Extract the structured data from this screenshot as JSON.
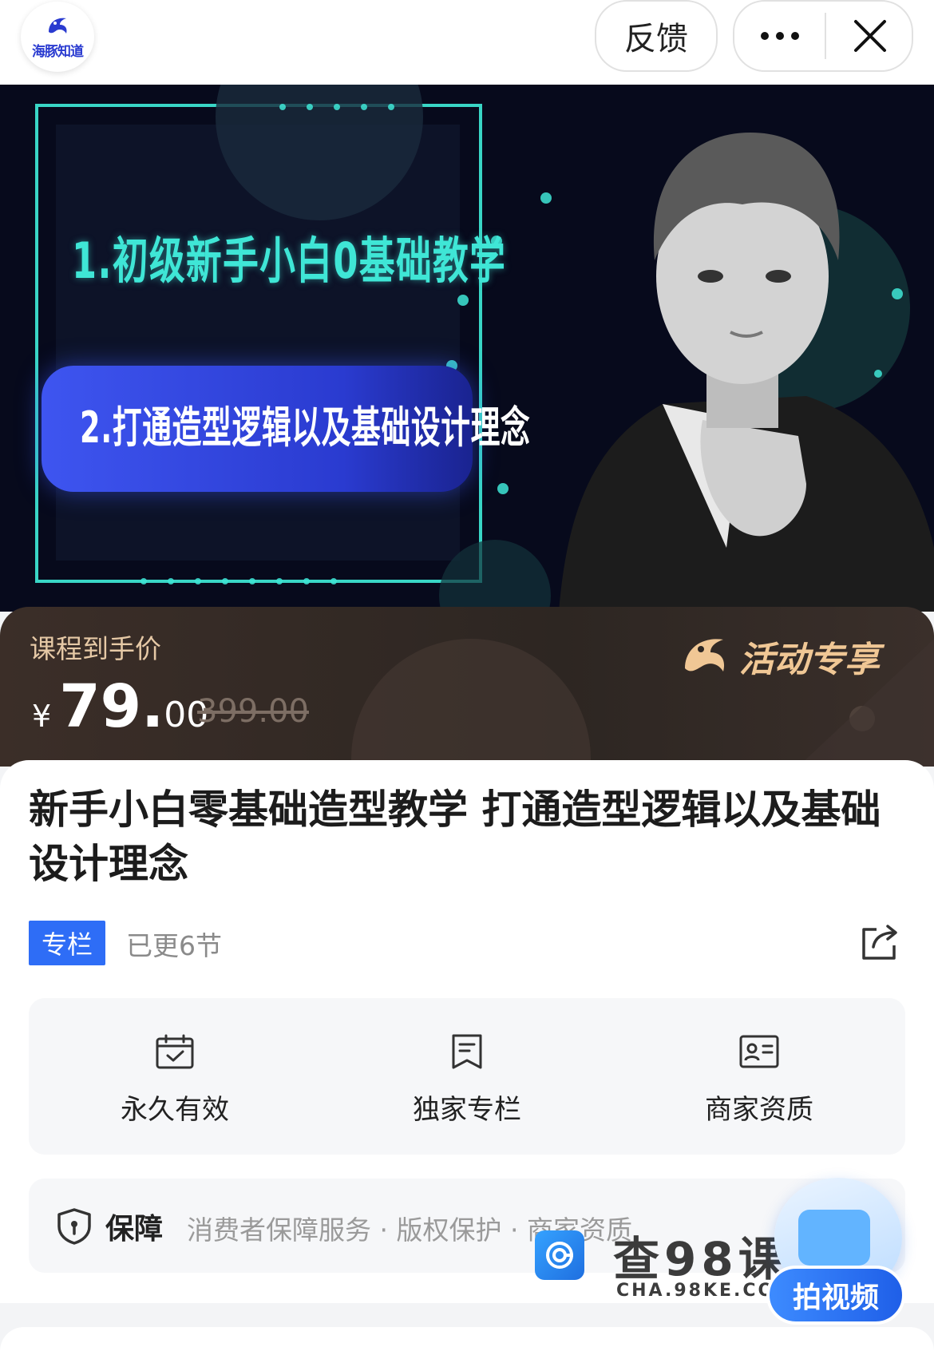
{
  "header": {
    "logo_text": "海豚知道",
    "feedback_label": "反馈",
    "more_icon": "more-dots-icon",
    "close_icon": "close-icon"
  },
  "banner": {
    "line1": "1.初级新手小白0基础教学",
    "line2": "2.打通造型逻辑以及基础设计理念"
  },
  "price": {
    "label": "课程到手价",
    "currency": "¥",
    "integer": "79.",
    "decimal": "00",
    "original": "399.00",
    "activity_label": "活动专享"
  },
  "course": {
    "title": "新手小白零基础造型教学 打通造型逻辑以及基础设计理念",
    "tag": "专栏",
    "updated": "已更6节"
  },
  "features": [
    {
      "label": "永久有效",
      "icon": "calendar-check-icon"
    },
    {
      "label": "独家专栏",
      "icon": "document-bookmark-icon"
    },
    {
      "label": "商家资质",
      "icon": "id-card-icon"
    }
  ],
  "guarantee": {
    "title": "保障",
    "items": "消费者保障服务 · 版权保护 · 商家资质"
  },
  "watermark": {
    "text": "查98课",
    "url": "CHA.98KE.COM"
  },
  "float_button": {
    "label": "拍视频"
  },
  "colors": {
    "accent_blue": "#2e6df6",
    "banner_cyan": "#3fe6d6",
    "price_gold": "#e6c9a6"
  }
}
